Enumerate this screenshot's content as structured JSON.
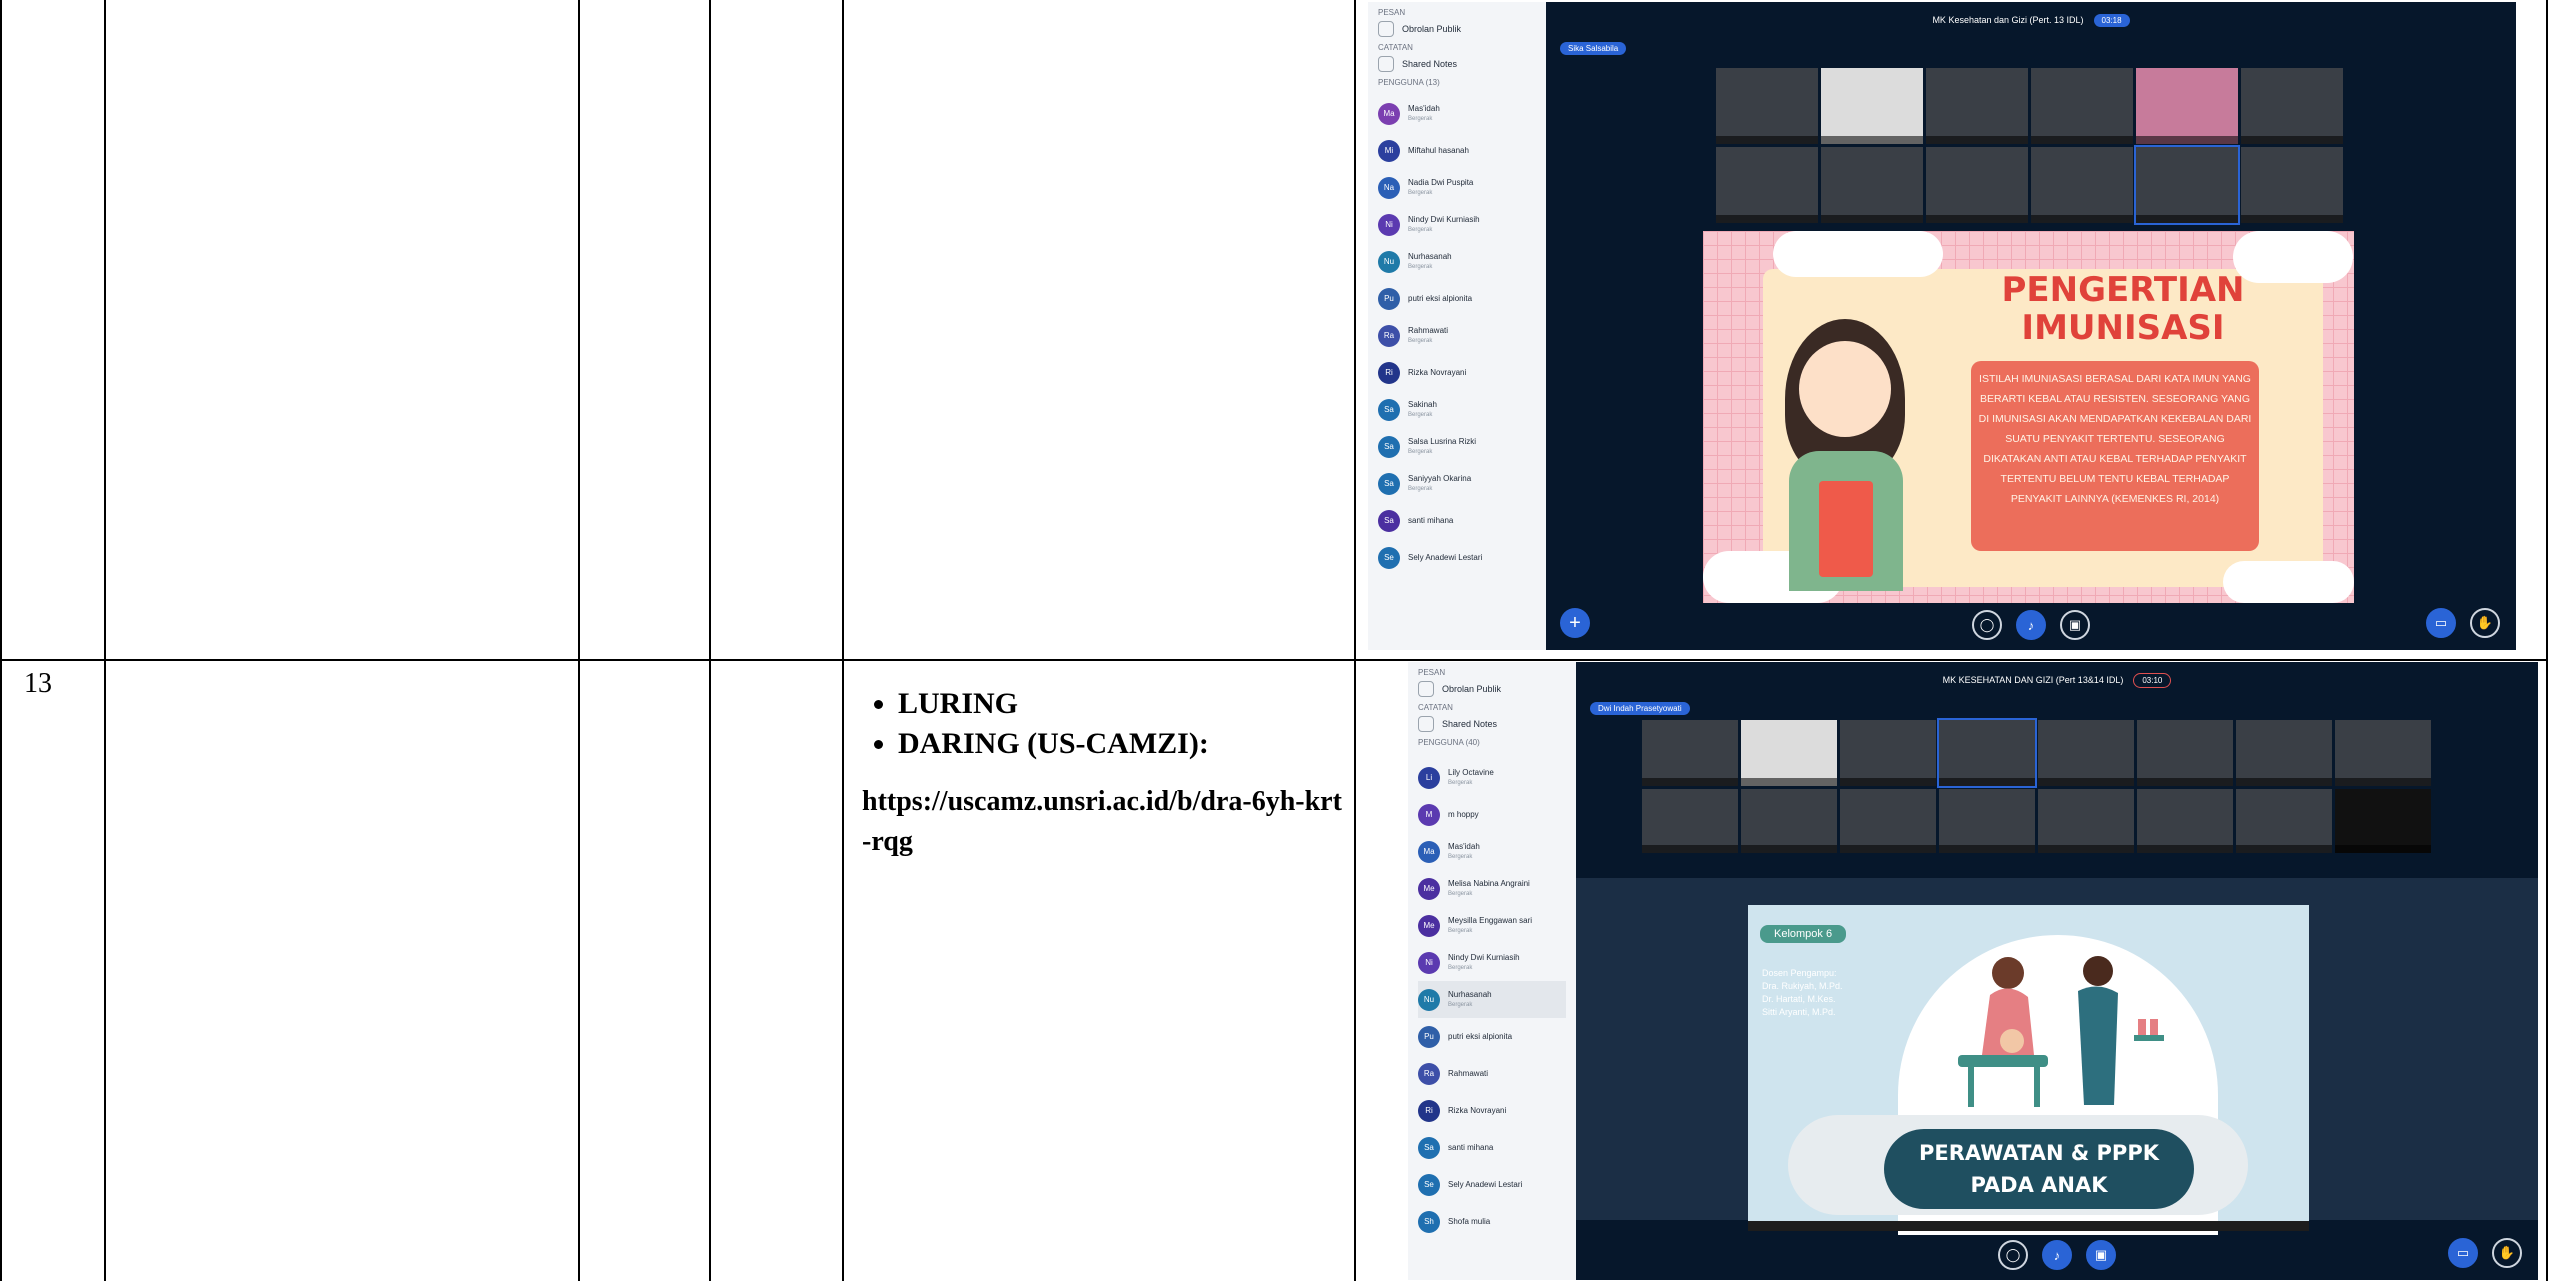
{
  "row": {
    "number": "13",
    "methods": [
      "LURING",
      "DARING (US-CAMZI):"
    ],
    "url": "https://uscamz.unsri.ac.id/b/dra-6yh-krt-rqg"
  },
  "shot1": {
    "sidebar": {
      "pesan_label": "PESAN",
      "public_chat": "Obrolan Publik",
      "catatan_label": "CATATAN",
      "shared_notes": "Shared Notes",
      "users_label": "PENGGUNA (13)",
      "users": [
        {
          "initials": "Ma",
          "name": "Mas'idah",
          "status": "Bergerak"
        },
        {
          "initials": "Mi",
          "name": "Miftahul hasanah",
          "status": ""
        },
        {
          "initials": "Na",
          "name": "Nadia Dwi Puspita",
          "status": "Bergerak"
        },
        {
          "initials": "Ni",
          "name": "Nindy Dwi Kurniasih",
          "status": "Bergerak"
        },
        {
          "initials": "Nu",
          "name": "Nurhasanah",
          "status": "Bergerak"
        },
        {
          "initials": "Pu",
          "name": "putri eksi alpionita",
          "status": ""
        },
        {
          "initials": "Ra",
          "name": "Rahmawati",
          "status": "Bergerak"
        },
        {
          "initials": "Ri",
          "name": "Rizka Novrayani",
          "status": ""
        },
        {
          "initials": "Sa",
          "name": "Sakinah",
          "status": "Bergerak"
        },
        {
          "initials": "Sa",
          "name": "Salsa Lusrina Rizki",
          "status": "Bergerak"
        },
        {
          "initials": "Sa",
          "name": "Saniyyah Okarina",
          "status": "Bergerak"
        },
        {
          "initials": "Sa",
          "name": "santi mihana",
          "status": ""
        },
        {
          "initials": "Se",
          "name": "Sely Anadewi Lestari",
          "status": ""
        }
      ]
    },
    "title": "MK Kesehatan dan Gizi (Pert. 13 IDL)",
    "timer": "03:18",
    "presenter": "Sika Salsabila",
    "slide": {
      "title_line1": "PENGERTIAN",
      "title_line2": "IMUNISASI",
      "body": "ISTILAH IMUNIASASI BERASAL DARI KATA IMUN YANG BERARTI KEBAL ATAU RESISTEN. SESEORANG YANG DI IMUNISASI AKAN MENDAPATKAN KEKEBALAN DARI SUATU PENYAKIT TERTENTU. SESEORANG DIKATAKAN ANTI ATAU KEBAL TERHADAP PENYAKIT TERTENTU BELUM TENTU KEBAL TERHADAP PENYAKIT LAINNYA (KEMENKES RI, 2014)"
    }
  },
  "shot2": {
    "sidebar": {
      "pesan_label": "PESAN",
      "public_chat": "Obrolan Publik",
      "catatan_label": "CATATAN",
      "shared_notes": "Shared Notes",
      "users_label": "PENGGUNA (40)",
      "users": [
        {
          "initials": "Li",
          "name": "Lily Octavine",
          "status": "Bergerak"
        },
        {
          "initials": "M",
          "name": "m hoppy",
          "status": ""
        },
        {
          "initials": "Ma",
          "name": "Mas'idah",
          "status": "Bergerak"
        },
        {
          "initials": "Me",
          "name": "Melisa Nabina Angraini",
          "status": "Bergerak"
        },
        {
          "initials": "Me",
          "name": "Meysilla Enggawan sari",
          "status": "Bergerak"
        },
        {
          "initials": "Ni",
          "name": "Nindy Dwi Kurniasih",
          "status": "Bergerak"
        },
        {
          "initials": "Nu",
          "name": "Nurhasanah",
          "status": "Bergerak"
        },
        {
          "initials": "Pu",
          "name": "putri eksi alpionita",
          "status": ""
        },
        {
          "initials": "Ra",
          "name": "Rahmawati",
          "status": ""
        },
        {
          "initials": "Ri",
          "name": "Rizka Novrayani",
          "status": ""
        },
        {
          "initials": "Sa",
          "name": "santi mihana",
          "status": ""
        },
        {
          "initials": "Se",
          "name": "Sely Anadewi Lestari",
          "status": ""
        },
        {
          "initials": "Sh",
          "name": "Shofa mulia",
          "status": ""
        }
      ]
    },
    "title": "MK KESEHATAN DAN GIZI (Pert 13&14 IDL)",
    "timer": "03:10",
    "presenter": "Dwi Indah Prasetyowati",
    "slide": {
      "group": "Kelompok 6",
      "dosen_label": "Dosen Pengampu:",
      "dosen_1": "Dra. Rukiyah, M.Pd.",
      "dosen_2": "Dr. Hartati, M.Kes.",
      "dosen_3": "Sitti Aryanti, M.Pd.",
      "title_line1": "PERAWATAN & PPPK",
      "title_line2": "PADA ANAK"
    }
  },
  "colors": {
    "accent": "#2a64d6",
    "conference_bg": "#06172b",
    "sidebar_bg": "#f3f5f8"
  }
}
